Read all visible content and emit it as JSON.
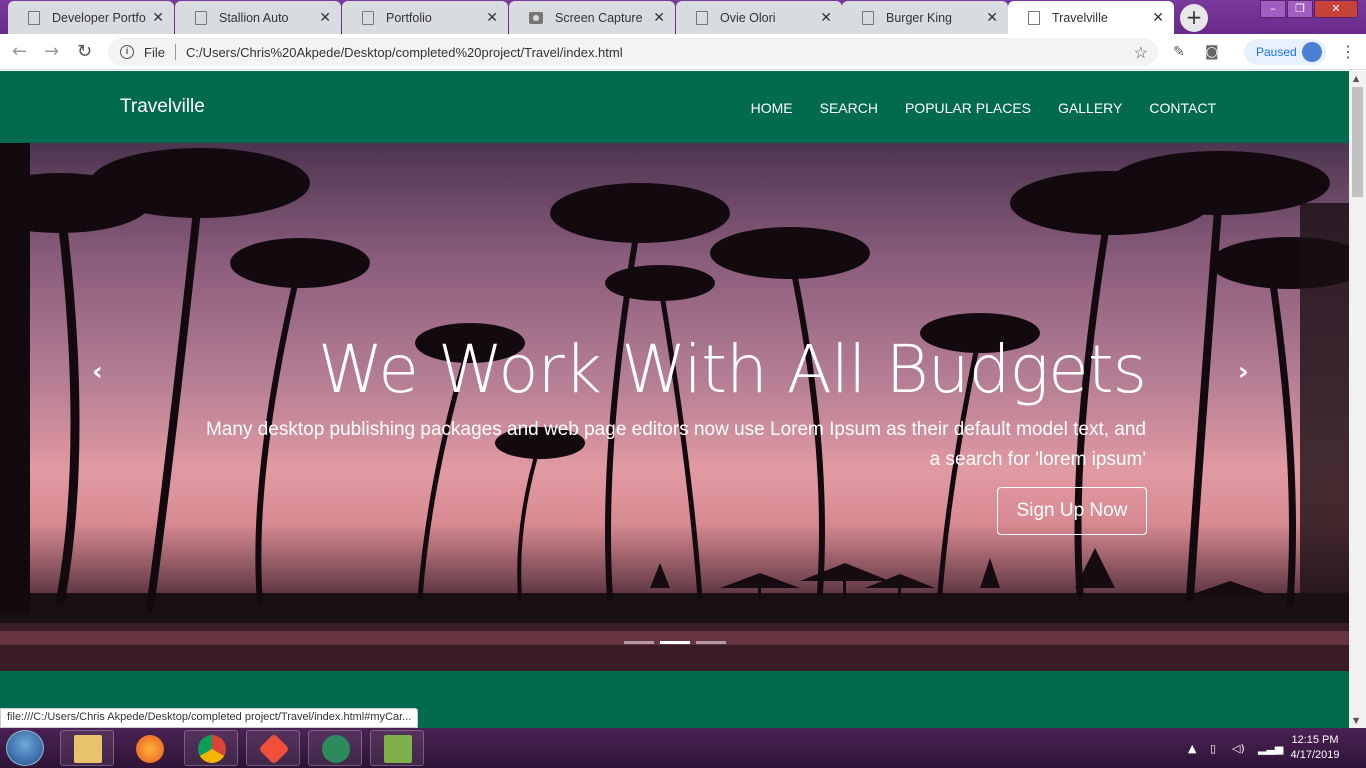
{
  "browser": {
    "tabs": [
      {
        "title": "Developer Portfolio",
        "icon": "page-icon",
        "active": false
      },
      {
        "title": "Stallion Auto",
        "icon": "page-icon",
        "active": false
      },
      {
        "title": "Portfolio",
        "icon": "page-icon",
        "active": false
      },
      {
        "title": "Screen Capture Re",
        "icon": "camera-icon",
        "active": false
      },
      {
        "title": "Ovie Olori",
        "icon": "page-icon",
        "active": false
      },
      {
        "title": "Burger King",
        "icon": "page-icon",
        "active": false
      },
      {
        "title": "Travelville",
        "icon": "page-icon",
        "active": true
      }
    ],
    "address_scheme": "File",
    "address": "C:/Users/Chris%20Akpede/Desktop/completed%20project/Travel/index.html",
    "profile_status": "Paused",
    "status_url": "file:///C:/Users/Chris Akpede/Desktop/completed project/Travel/index.html#myCar..."
  },
  "site": {
    "brand": "Travelville",
    "nav": [
      "HOME",
      "SEARCH",
      "POPULAR PLACES",
      "GALLERY",
      "CONTACT"
    ],
    "hero": {
      "title": "We Work With All Budgets",
      "subtitle": "Many desktop publishing packages and web page editors now use Lorem Ipsum as their default model text, and a search for 'lorem ipsum'",
      "cta": "Sign Up Now",
      "slide_count": 3,
      "active_slide": 2
    },
    "colors": {
      "brand_green": "#036b4d"
    }
  },
  "taskbar": {
    "time": "12:15 PM",
    "date": "4/17/2019"
  }
}
